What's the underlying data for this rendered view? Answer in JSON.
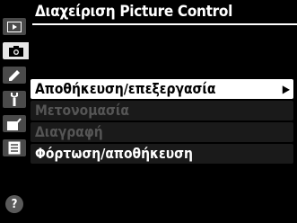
{
  "header": {
    "title": "Διαχείριση Picture Control"
  },
  "sidebar": {
    "tabs": [
      {
        "icon": "playback-icon",
        "active": false
      },
      {
        "icon": "camera-icon",
        "active": true
      },
      {
        "icon": "pencil-icon",
        "active": false
      },
      {
        "icon": "wrench-icon",
        "active": false
      },
      {
        "icon": "retouch-icon",
        "active": false
      },
      {
        "icon": "recent-settings-icon",
        "active": false
      }
    ],
    "help_label": "?"
  },
  "menu": {
    "items": [
      {
        "label": "Αποθήκευση/επεξεργασία",
        "state": "selected",
        "has_submenu": true
      },
      {
        "label": "Μετονομασία",
        "state": "disabled",
        "has_submenu": false
      },
      {
        "label": "Διαγραφή",
        "state": "disabled",
        "has_submenu": false
      },
      {
        "label": "Φόρτωση/αποθήκευση",
        "state": "normal",
        "has_submenu": false
      }
    ],
    "submenu_arrow": "▶"
  },
  "colors": {
    "background": "#000000",
    "selected": "#ffffff",
    "disabled_text": "#555555",
    "tab": "#4a4a4a"
  }
}
